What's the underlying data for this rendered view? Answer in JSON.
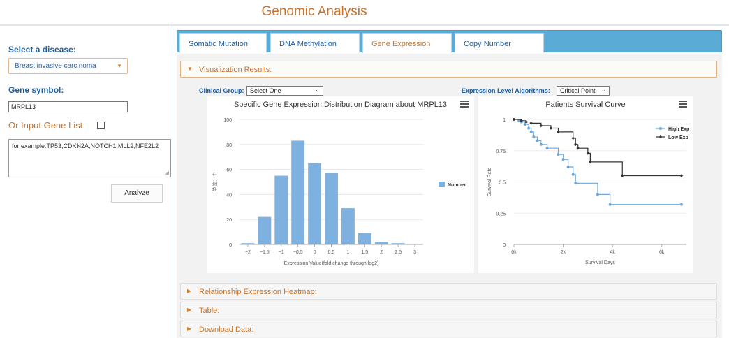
{
  "page": {
    "title": "Genomic Analysis"
  },
  "sidebar": {
    "disease_label": "Select a disease:",
    "disease_value": "Breast invasive carcinoma",
    "gene_symbol_label": "Gene symbol:",
    "gene_symbol_value": "MRPL13",
    "gene_list_label": "Or Input Gene List",
    "gene_list_placeholder": "for example:TP53,CDKN2A,NOTCH1,MLL2,NFE2L2",
    "analyze_label": "Analyze"
  },
  "tabs": [
    {
      "label": "Somatic Mutation",
      "active": false
    },
    {
      "label": "DNA Methylation",
      "active": false
    },
    {
      "label": "Gene Expression",
      "active": true
    },
    {
      "label": "Copy Number",
      "active": false
    }
  ],
  "accordion": {
    "visualization": "Visualization Results:",
    "heatmap": "Relationship Expression Heatmap:",
    "table": "Table:",
    "download": "Download Data:"
  },
  "controls": {
    "clinical_group_label": "Clinical Group:",
    "clinical_group_value": "Select One",
    "algorithm_label": "Expression Level Algorithms:",
    "algorithm_value": "Critical Point"
  },
  "colors": {
    "accent": "#c8742e",
    "link": "#1d5fa3",
    "tab_bar": "#5aabd6",
    "high_exp": "#6fa8dc",
    "low_exp": "#333333"
  },
  "chart_data": [
    {
      "type": "bar",
      "title": "Specific Gene Expression Distribution Diagram about MRPL13",
      "xlabel": "Expression Value(fold change through log2)",
      "ylabel": "单位：个",
      "legend": [
        "Number"
      ],
      "x_ticks": [
        "−2",
        "−1.5",
        "−1",
        "−0.5",
        "0",
        "0.5",
        "1",
        "1.5",
        "2",
        "2.5",
        "3"
      ],
      "y_ticks": [
        "0",
        "20",
        "40",
        "60",
        "80",
        "100"
      ],
      "ylim": [
        0,
        100
      ],
      "bar_width": 0.5,
      "series": [
        {
          "name": "Number",
          "x": [
            -2,
            -1.5,
            -1,
            -0.5,
            0,
            0.5,
            1,
            1.5,
            2,
            2.5
          ],
          "values": [
            1,
            22,
            55,
            83,
            65,
            57,
            29,
            9,
            2,
            1
          ]
        }
      ]
    },
    {
      "type": "line",
      "title": "Patients Survival Curve",
      "xlabel": "Survival Days",
      "ylabel": "Survival Rate",
      "x_ticks": [
        "0k",
        "2k",
        "4k",
        "6k"
      ],
      "y_ticks": [
        "0",
        "0.25",
        "0.5",
        "0.75",
        "1"
      ],
      "xlim": [
        0,
        7000
      ],
      "ylim": [
        0,
        1
      ],
      "legend_position": "top-right",
      "series": [
        {
          "name": "High Exp",
          "x": [
            0,
            200,
            300,
            450,
            600,
            700,
            800,
            950,
            1100,
            1350,
            1800,
            2000,
            2200,
            2400,
            2500,
            3400,
            3900,
            6800
          ],
          "y": [
            1.0,
            0.99,
            0.98,
            0.96,
            0.93,
            0.9,
            0.86,
            0.83,
            0.8,
            0.77,
            0.72,
            0.68,
            0.62,
            0.56,
            0.49,
            0.4,
            0.32,
            0.32
          ]
        },
        {
          "name": "Low Exp",
          "x": [
            0,
            300,
            500,
            700,
            1100,
            1500,
            1800,
            2400,
            2500,
            2600,
            3000,
            3100,
            4400,
            6800
          ],
          "y": [
            1.0,
            0.99,
            0.98,
            0.97,
            0.95,
            0.93,
            0.9,
            0.85,
            0.8,
            0.77,
            0.73,
            0.66,
            0.55,
            0.55
          ]
        }
      ]
    }
  ]
}
